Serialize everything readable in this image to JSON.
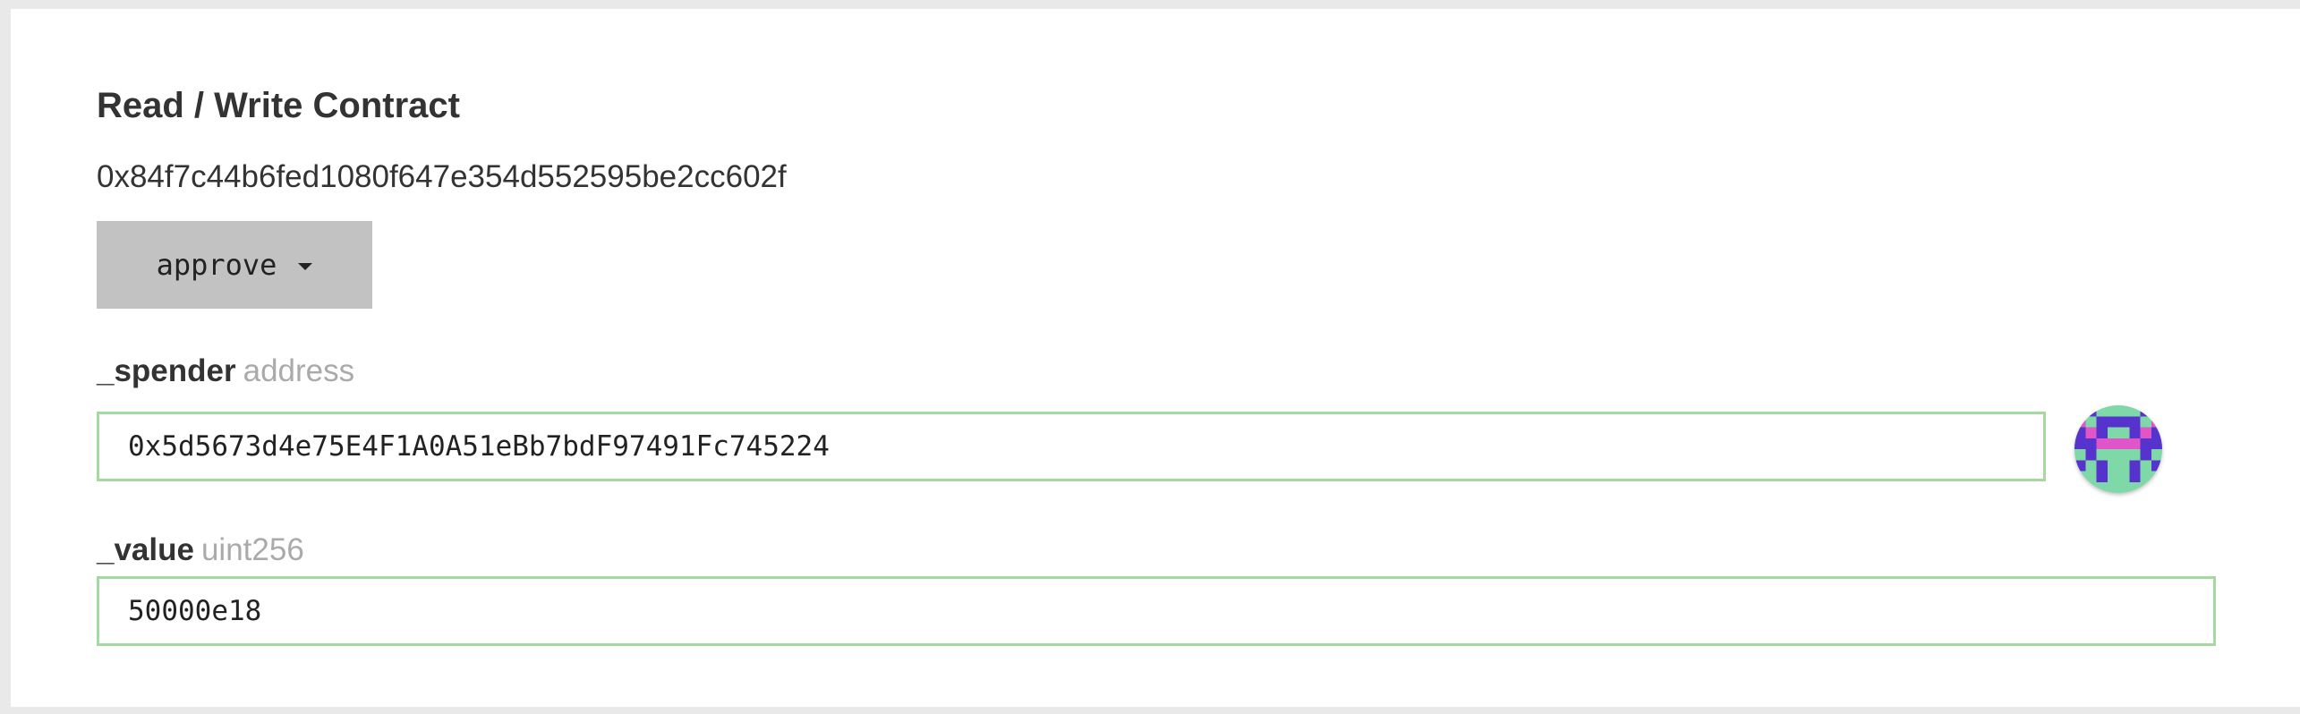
{
  "contract": {
    "title": "Read / Write Contract",
    "address": "0x84f7c44b6fed1080f647e354d552595be2cc602f"
  },
  "function_selector": {
    "label": "approve"
  },
  "params": [
    {
      "name": "_spender",
      "type": "address",
      "value": "0x5d5673d4e75E4F1A0A51eBb7bdF97491Fc745224"
    },
    {
      "name": "_value",
      "type": "uint256",
      "value": "50000e18"
    }
  ],
  "colors": {
    "input_border": "#a5d9a0",
    "button_bg": "#c2c2c2",
    "identicon_bg": "#7ed8a8",
    "identicon_primary": "#5533cc",
    "identicon_spot": "#e055c8"
  },
  "icons": {
    "identicon": "address-identicon",
    "dropdown": "caret-down-icon"
  }
}
